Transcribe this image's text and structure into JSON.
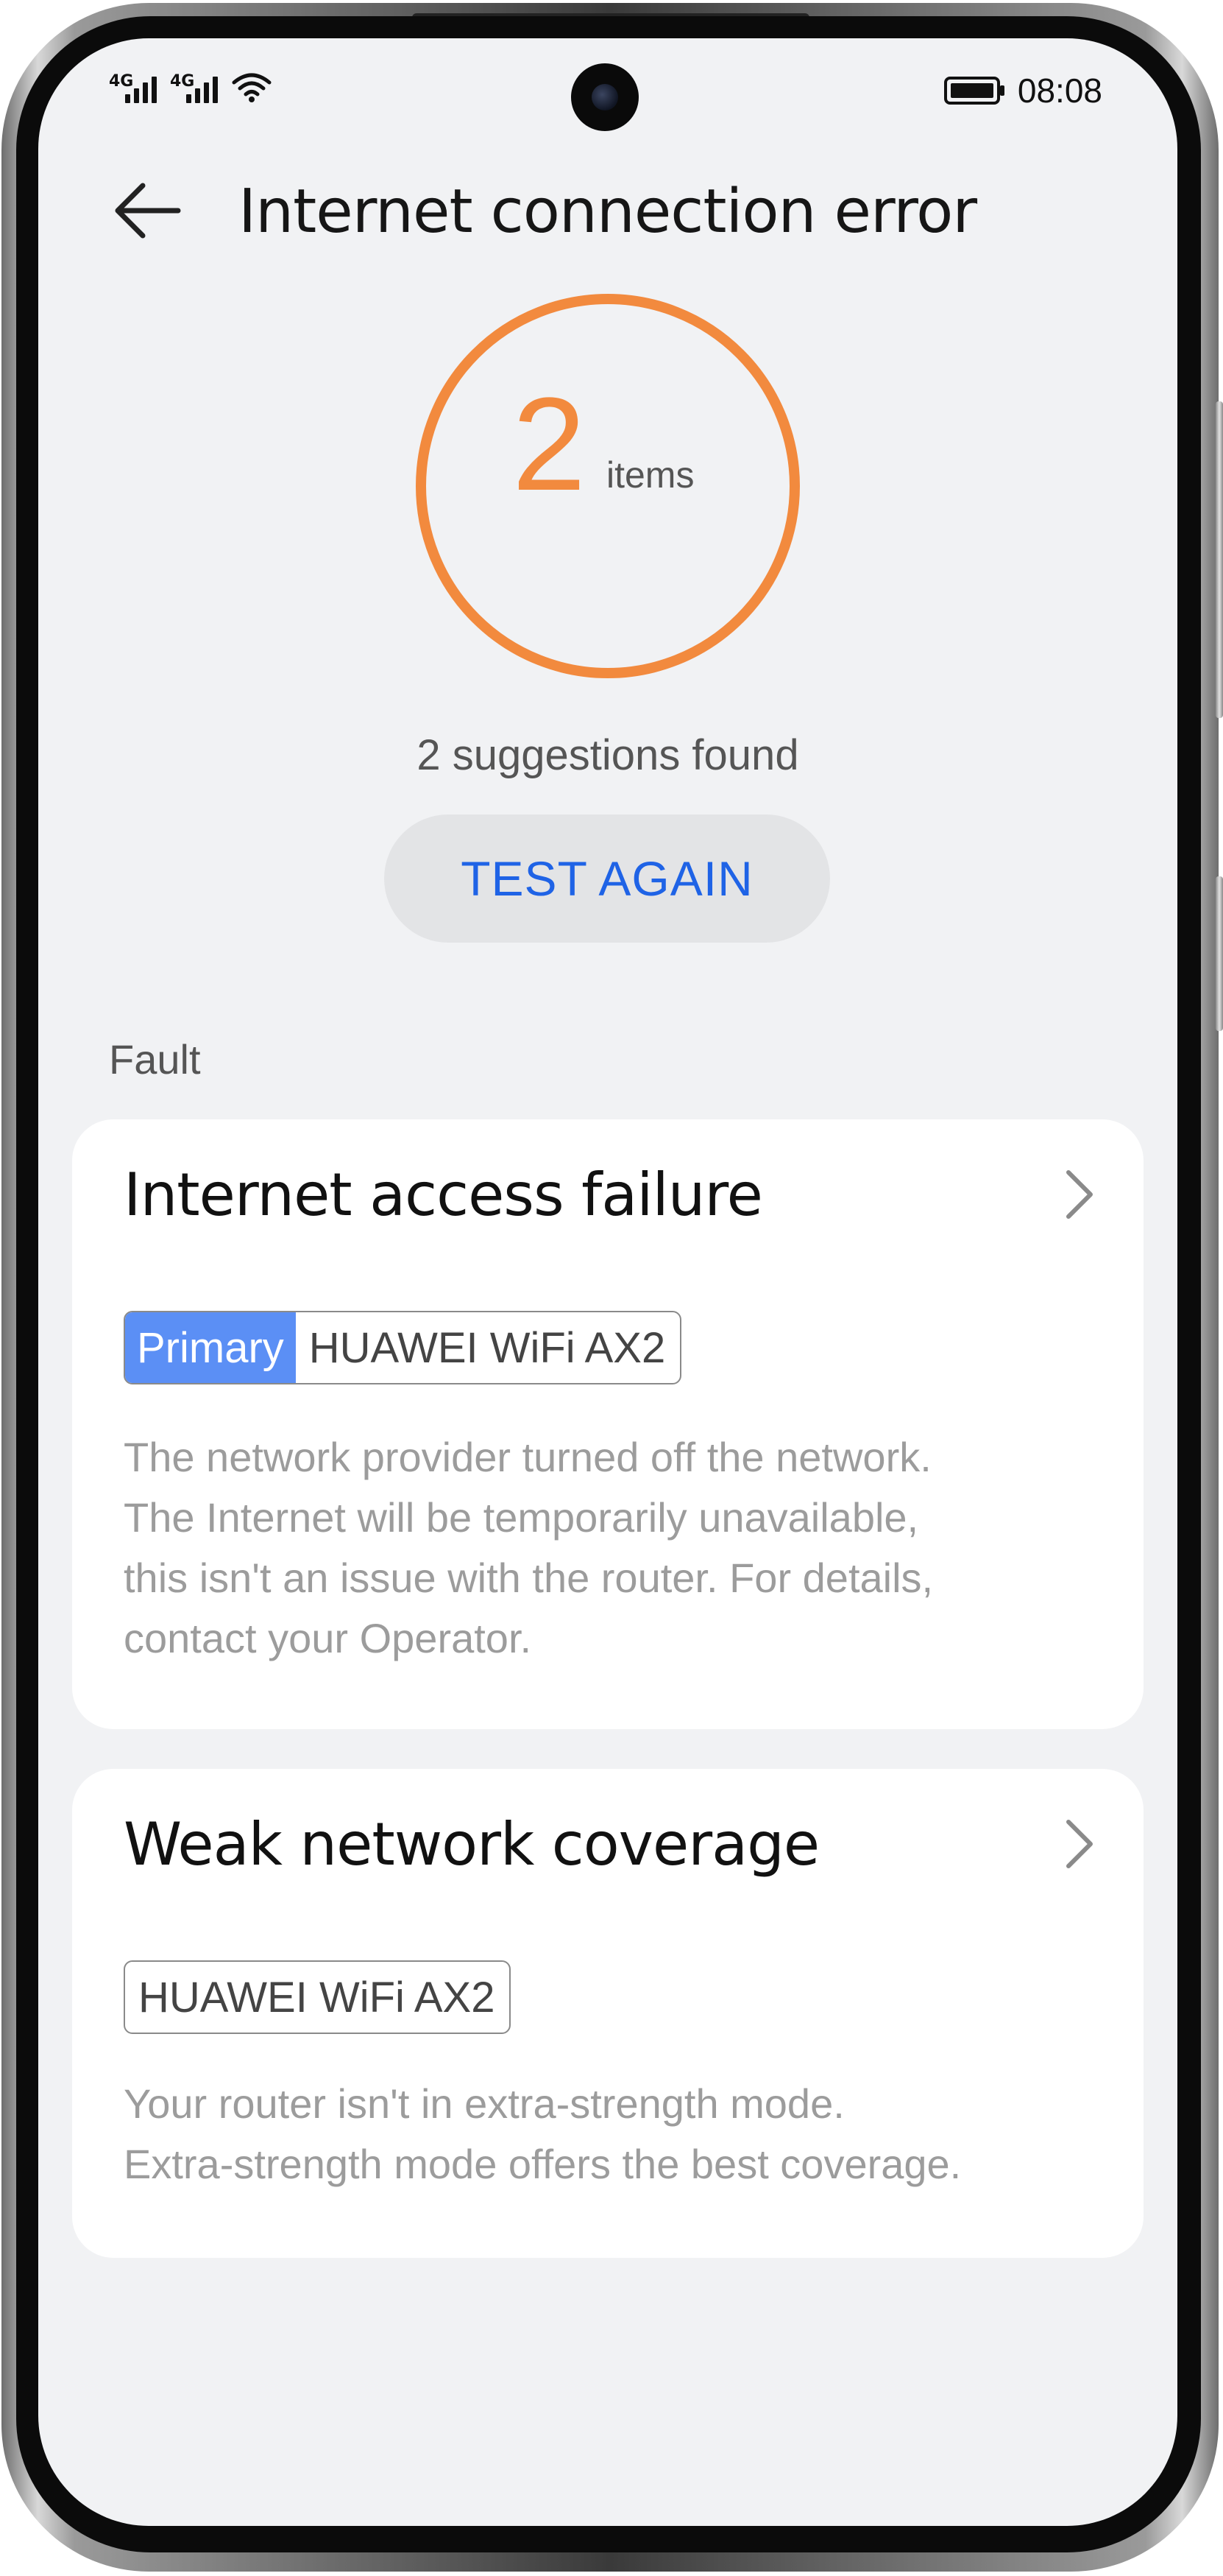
{
  "status_bar": {
    "sim1_network": "4G",
    "sim2_network": "4G",
    "signal_bars_sim1": 4,
    "signal_bars_sim2": 4,
    "time": "08:08",
    "icons": [
      "signal-icon",
      "signal-icon",
      "wifi-icon",
      "battery-icon"
    ]
  },
  "header": {
    "back_icon": "arrow-left-icon",
    "title": "Internet connection error"
  },
  "result": {
    "count": "2",
    "unit": "items",
    "summary": "2 suggestions found",
    "ring_color": "#f28a3e"
  },
  "actions": {
    "test_again_label": "TEST AGAIN",
    "accent_color": "#1f63e6"
  },
  "section": {
    "label": "Fault"
  },
  "faults": [
    {
      "title": "Internet access failure",
      "primary_tag": "Primary",
      "device": "HUAWEI WiFi AX2",
      "description_lines": [
        "The network provider turned off the network.",
        "The Internet will be temporarily unavailable,",
        "this isn't an issue with the router. For details,",
        "contact your Operator."
      ]
    },
    {
      "title": "Weak network coverage",
      "device": "HUAWEI WiFi AX2",
      "description_lines": [
        "Your router isn't in extra-strength mode.",
        "Extra-strength mode offers the best coverage."
      ]
    }
  ],
  "colors": {
    "background": "#f1f2f4",
    "card": "#ffffff",
    "primary_tag": "#5b8ff5",
    "description_text": "#9c9c9c"
  }
}
